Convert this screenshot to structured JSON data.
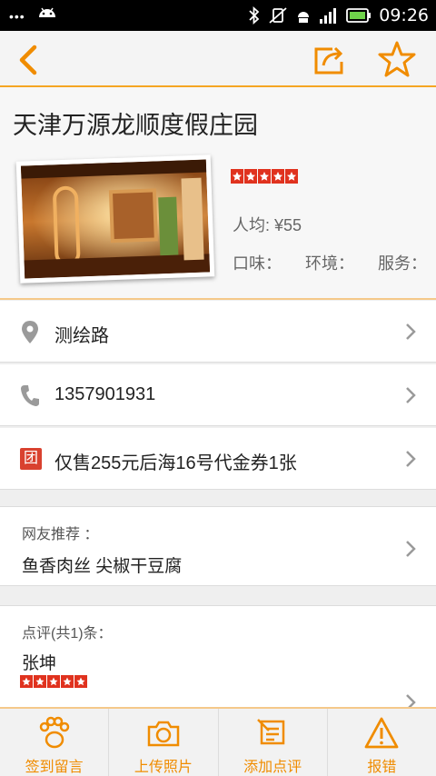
{
  "status_bar": {
    "time": "09:26"
  },
  "colors": {
    "accent": "#f08c00",
    "star_red": "#e0321e",
    "tuan_badge": "#d9412f"
  },
  "header": {
    "title": "天津万源龙顺度假庄园",
    "stars": 5,
    "avg_price": "人均: ¥55",
    "ratings": [
      "口味：",
      "环境：",
      "服务："
    ]
  },
  "rows": {
    "address": "测绘路",
    "phone": "1357901931",
    "deal_badge": "团",
    "deal": "仅售255元后海16号代金券1张"
  },
  "recommend": {
    "label": "网友推荐 ：",
    "dishes": "鱼香肉丝  尖椒干豆腐"
  },
  "review": {
    "label": "点评(共1)条：",
    "user": "张坤",
    "stars": 5
  },
  "bottom_tabs": [
    {
      "label": "签到留言",
      "icon": "paw-icon"
    },
    {
      "label": "上传照片",
      "icon": "camera-icon"
    },
    {
      "label": "添加点评",
      "icon": "edit-review-icon"
    },
    {
      "label": "报错",
      "icon": "warning-icon"
    }
  ]
}
